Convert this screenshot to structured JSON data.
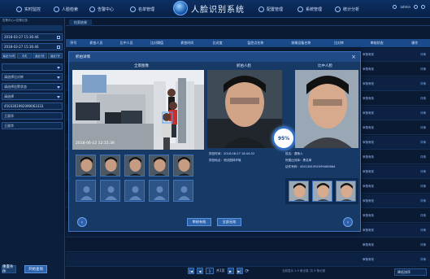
{
  "nav": {
    "items": [
      "实时监控",
      "人脸检索",
      "告警中心",
      "名单管理",
      "配置管理",
      "系统管理",
      "统计分析"
    ],
    "app_title": "人脸识别系统",
    "user_label": "admin"
  },
  "left_panel": {
    "breadcrumb": "告警中心>告警记录",
    "start_time": "2018-03-27  15:36:46",
    "end_time": "2018-03-27  15:36:46",
    "quick_ranges": [
      "最近7小时",
      "今天",
      "最近3天",
      "最近7天"
    ],
    "selects": [
      "请选择比对库",
      "请选择告警状态",
      "请选择"
    ],
    "id_value": "4503361992099063333",
    "inputs": [
      "王丽华",
      "王丽华"
    ],
    "reset_label": "重置条件",
    "search_label": "开始查询"
  },
  "table": {
    "tab_label": "检索结果",
    "headers": [
      "序号",
      "抓拍人员",
      "比中人员",
      "比对阈值",
      "抓拍时间",
      "比对度",
      "监控点名称",
      "前端设备名称",
      "比对库",
      "审核状态",
      "操作"
    ],
    "rows": [
      {
        "status": "审核有效",
        "op": "详情"
      },
      {
        "status": "审核有效",
        "op": "详情"
      },
      {
        "status": "审核有效",
        "op": "详情"
      },
      {
        "status": "审核有效",
        "op": "详情"
      },
      {
        "status": "审核有效",
        "op": "详情"
      },
      {
        "status": "审核有效",
        "op": "详情"
      },
      {
        "status": "审核有效",
        "op": "详情"
      },
      {
        "status": "审核有效",
        "op": "详情"
      },
      {
        "status": "审核有效",
        "op": "详情"
      },
      {
        "status": "审核有效",
        "op": "详情"
      },
      {
        "status": "审核有效",
        "op": "详情"
      },
      {
        "status": "审核有效",
        "op": "详情"
      },
      {
        "status": "审核有效",
        "op": "详情"
      },
      {
        "status": "审核有效",
        "op": "详情"
      },
      {
        "status": "审核有效",
        "op": "详情"
      }
    ],
    "pager": {
      "page": "1",
      "total_pages": "共1页",
      "info": "当前显示 1-9 条记录, 共 9 条记录"
    },
    "sort_label": "降低排序"
  },
  "modal": {
    "title": "抓拍详情",
    "scene_label": "全景图像",
    "capture_label": "抓拍人脸",
    "compare_label": "比中人脸",
    "scene_timestamp": "2018-06-12  12:15:39",
    "similarity": "95%",
    "capture_time": "抓拍时间：2018-06-27    18:44:52",
    "capture_place": "抓拍地点：测试园林环境",
    "person_name": "姓名：谭杨人",
    "person_library": "所属比对库：黑名单",
    "person_id": "证件号码：4501361992099065864",
    "audit_valid": "审核有效",
    "audit_invalid": "全部无效"
  },
  "colors": {
    "accent": "#2c63ad",
    "score_ring": "#2d6fd0",
    "background": "#0a1a33"
  }
}
